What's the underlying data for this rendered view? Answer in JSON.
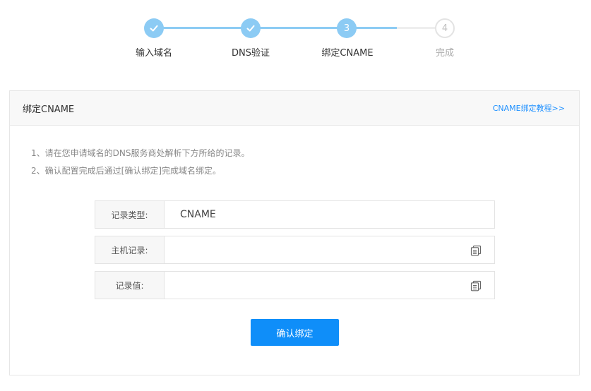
{
  "stepper": {
    "steps": [
      {
        "number": "1",
        "label": "输入域名",
        "state": "done"
      },
      {
        "number": "2",
        "label": "DNS验证",
        "state": "done"
      },
      {
        "number": "3",
        "label": "绑定CNAME",
        "state": "current"
      },
      {
        "number": "4",
        "label": "完成",
        "state": "todo"
      }
    ]
  },
  "panel": {
    "title": "绑定CNAME",
    "tutorial_link": "CNAME绑定教程>>",
    "notes": [
      "1、请在您申请域名的DNS服务商处解析下方所给的记录。",
      "2、确认配置完成后通过[确认绑定]完成域名绑定。"
    ],
    "fields": [
      {
        "label": "记录类型:",
        "value": "CNAME"
      },
      {
        "label": "主机记录:",
        "value": ""
      },
      {
        "label": "记录值:",
        "value": ""
      }
    ],
    "confirm_label": "确认绑定"
  },
  "colors": {
    "step_active": "#8ccbf4",
    "step_inactive": "#e3e3e3",
    "primary": "#0f8ef9",
    "link": "#1e90ff"
  }
}
